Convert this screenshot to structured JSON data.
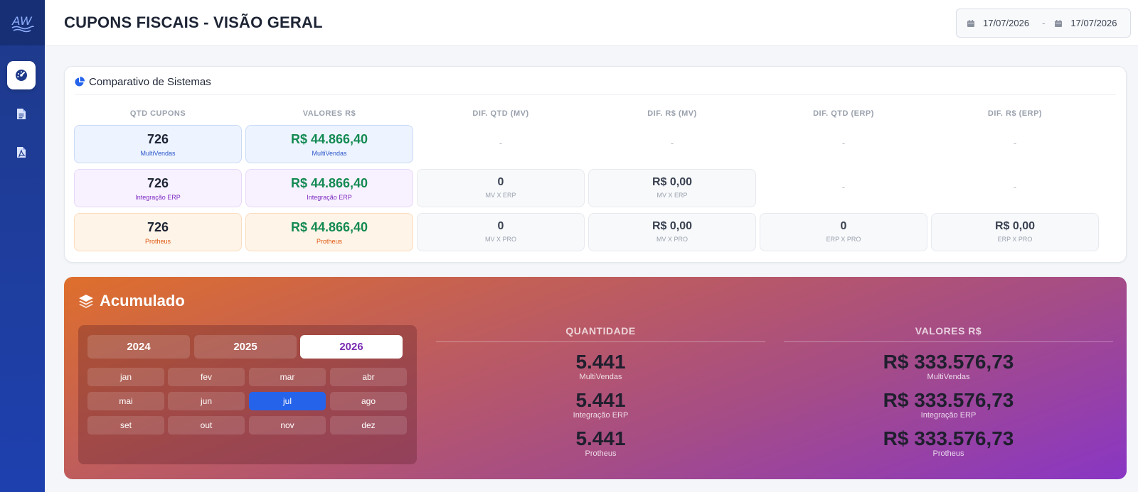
{
  "app": {
    "logo_text": "AW"
  },
  "header": {
    "title": "CUPONS FISCAIS - VISÃO GERAL",
    "date_from": "17/07/2026",
    "date_separator": "-",
    "date_to": "17/07/2026"
  },
  "sidebar": {
    "items": [
      {
        "icon": "dashboard-gauge-icon",
        "active": true
      },
      {
        "icon": "document-icon",
        "active": false
      },
      {
        "icon": "pdf-file-icon",
        "active": false
      }
    ]
  },
  "comparativo": {
    "title": "Comparativo de Sistemas",
    "columns": [
      "QTD CUPONS",
      "VALORES R$",
      "DIF. QTD (MV)",
      "DIF. R$ (MV)",
      "DIF. QTD (ERP)",
      "DIF. R$ (ERP)"
    ],
    "rows": [
      {
        "qtd": {
          "value": "726",
          "label": "MultiVendas"
        },
        "valor": {
          "value": "R$ 44.866,40",
          "label": "MultiVendas"
        },
        "dif_qtd_mv": "-",
        "dif_val_mv": "-",
        "dif_qtd_erp": "-",
        "dif_val_erp": "-"
      },
      {
        "qtd": {
          "value": "726",
          "label": "Integração ERP"
        },
        "valor": {
          "value": "R$ 44.866,40",
          "label": "Integração ERP"
        },
        "dif_qtd_mv": {
          "value": "0",
          "label": "MV X ERP"
        },
        "dif_val_mv": {
          "value": "R$ 0,00",
          "label": "MV X ERP"
        },
        "dif_qtd_erp": "-",
        "dif_val_erp": "-"
      },
      {
        "qtd": {
          "value": "726",
          "label": "Protheus"
        },
        "valor": {
          "value": "R$ 44.866,40",
          "label": "Protheus"
        },
        "dif_qtd_mv": {
          "value": "0",
          "label": "MV X PRO"
        },
        "dif_val_mv": {
          "value": "R$ 0,00",
          "label": "MV X PRO"
        },
        "dif_qtd_erp": {
          "value": "0",
          "label": "ERP X PRO"
        },
        "dif_val_erp": {
          "value": "R$ 0,00",
          "label": "ERP X PRO"
        }
      }
    ]
  },
  "acumulado": {
    "title": "Acumulado",
    "years": [
      "2024",
      "2025",
      "2026"
    ],
    "selected_year": "2026",
    "months": [
      "jan",
      "fev",
      "mar",
      "abr",
      "mai",
      "jun",
      "jul",
      "ago",
      "set",
      "out",
      "nov",
      "dez"
    ],
    "selected_month": "jul",
    "quantidade": {
      "header": "QUANTIDADE",
      "items": [
        {
          "value": "5.441",
          "label": "MultiVendas"
        },
        {
          "value": "5.441",
          "label": "Integração ERP"
        },
        {
          "value": "5.441",
          "label": "Protheus"
        }
      ]
    },
    "valores": {
      "header": "VALORES R$",
      "items": [
        {
          "value": "R$ 333.576,73",
          "label": "MultiVendas"
        },
        {
          "value": "R$ 333.576,73",
          "label": "Integração ERP"
        },
        {
          "value": "R$ 333.576,73",
          "label": "Protheus"
        }
      ]
    }
  },
  "colors": {
    "sidebar": "#1e3a8a",
    "accent_green": "#138a52",
    "accent_blue": "#2563eb",
    "gradient_start": "#df6f2c",
    "gradient_end": "#8936c4"
  }
}
